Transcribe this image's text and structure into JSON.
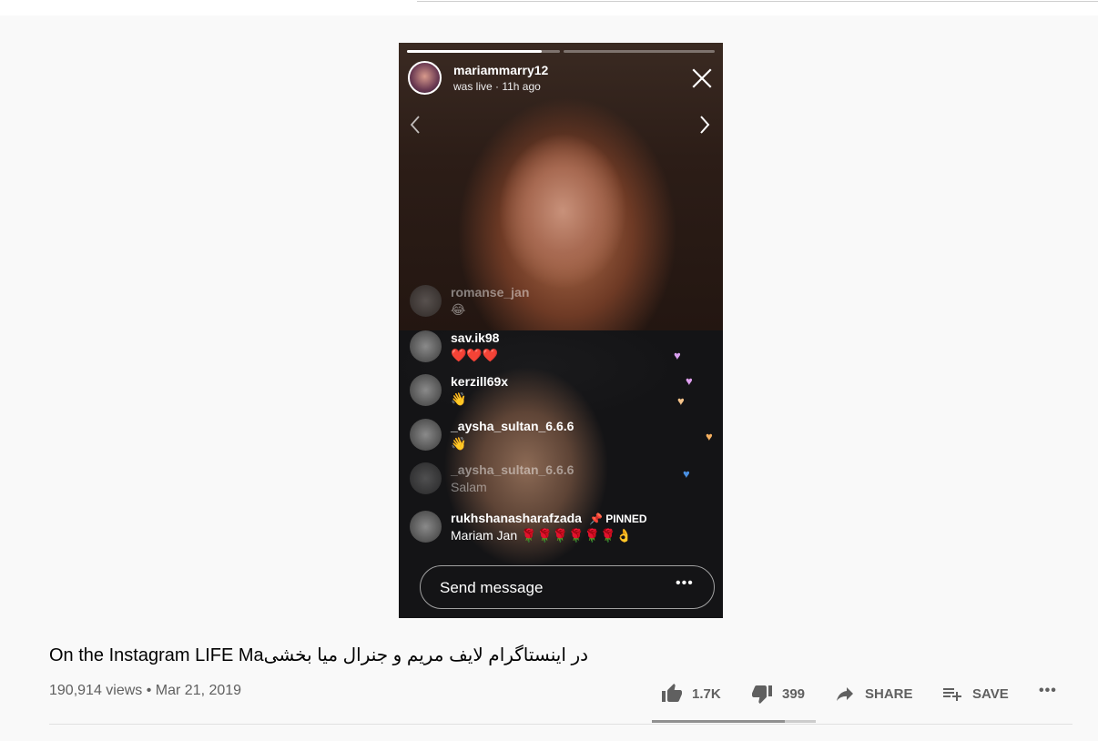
{
  "story": {
    "host_username": "mariammarry12",
    "host_status": "was live · 11h ago",
    "comments": [
      {
        "user": "romanse_jan",
        "text": "😂",
        "faded": true
      },
      {
        "user": "sav.ik98",
        "text": "❤️❤️❤️",
        "faded": false
      },
      {
        "user": "kerzill69x",
        "text": "👋",
        "faded": false
      },
      {
        "user": "_aysha_sultan_6.6.6",
        "text": "👋",
        "faded": false
      },
      {
        "user": "_aysha_sultan_6.6.6",
        "text": "Salam",
        "faded": true
      }
    ],
    "pinned_comment": {
      "user": "rukhshanasharafzada",
      "tag": "PINNED",
      "text": "Mariam Jan 🌹🌹🌹🌹🌹🌹👌"
    },
    "send_placeholder": "Send message",
    "more_label": "•••"
  },
  "video": {
    "title": "On the Instagram LIFE Maدر اینستاگرام لایف مریم و جنرال میا بخشی",
    "views": "190,914 views",
    "date": "Mar 21, 2019",
    "likes": "1.7K",
    "dislikes": "399",
    "share_label": "SHARE",
    "save_label": "SAVE",
    "more_label": "•••",
    "like_ratio": 0.81
  },
  "icons": {
    "like": "thumbs-up-icon",
    "dislike": "thumbs-down-icon",
    "share": "share-icon",
    "save": "playlist-add-icon",
    "close": "close-icon"
  }
}
